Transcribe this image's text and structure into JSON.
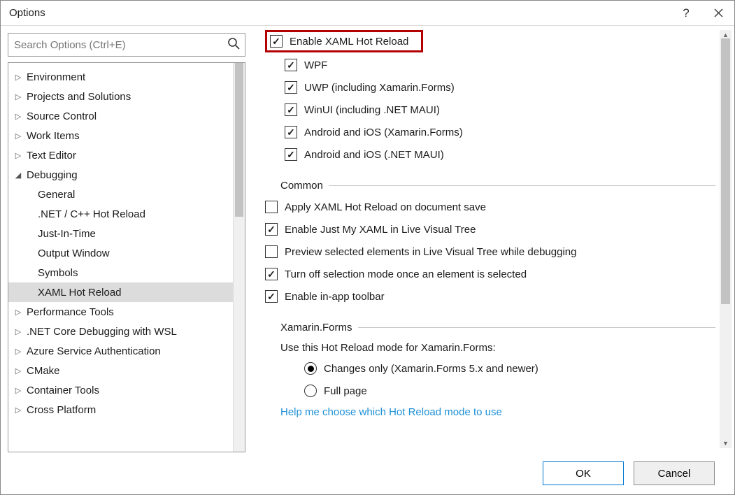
{
  "window": {
    "title": "Options"
  },
  "search": {
    "placeholder": "Search Options (Ctrl+E)"
  },
  "tree": [
    {
      "label": "Environment",
      "expanded": false,
      "level": 0
    },
    {
      "label": "Projects and Solutions",
      "expanded": false,
      "level": 0
    },
    {
      "label": "Source Control",
      "expanded": false,
      "level": 0
    },
    {
      "label": "Work Items",
      "expanded": false,
      "level": 0
    },
    {
      "label": "Text Editor",
      "expanded": false,
      "level": 0
    },
    {
      "label": "Debugging",
      "expanded": true,
      "level": 0
    },
    {
      "label": "General",
      "level": 1
    },
    {
      "label": ".NET / C++ Hot Reload",
      "level": 1
    },
    {
      "label": "Just-In-Time",
      "level": 1
    },
    {
      "label": "Output Window",
      "level": 1
    },
    {
      "label": "Symbols",
      "level": 1
    },
    {
      "label": "XAML Hot Reload",
      "level": 1,
      "selected": true
    },
    {
      "label": "Performance Tools",
      "expanded": false,
      "level": 0
    },
    {
      "label": ".NET Core Debugging with WSL",
      "expanded": false,
      "level": 0
    },
    {
      "label": "Azure Service Authentication",
      "expanded": false,
      "level": 0
    },
    {
      "label": "CMake",
      "expanded": false,
      "level": 0
    },
    {
      "label": "Container Tools",
      "expanded": false,
      "level": 0
    },
    {
      "label": "Cross Platform",
      "expanded": false,
      "level": 0
    }
  ],
  "main": {
    "enable": {
      "label": "Enable XAML Hot Reload",
      "checked": true
    },
    "platforms": [
      {
        "label": "WPF",
        "checked": true
      },
      {
        "label": "UWP (including Xamarin.Forms)",
        "checked": true
      },
      {
        "label": "WinUI (including .NET MAUI)",
        "checked": true
      },
      {
        "label": "Android and iOS (Xamarin.Forms)",
        "checked": true
      },
      {
        "label": "Android and iOS (.NET MAUI)",
        "checked": true
      }
    ],
    "commonHead": "Common",
    "common": [
      {
        "label": "Apply XAML Hot Reload on document save",
        "checked": false
      },
      {
        "label": "Enable Just My XAML in Live Visual Tree",
        "checked": true
      },
      {
        "label": "Preview selected elements in Live Visual Tree while debugging",
        "checked": false
      },
      {
        "label": "Turn off selection mode once an element is selected",
        "checked": true
      },
      {
        "label": "Enable in-app toolbar",
        "checked": true
      }
    ],
    "xamarinHead": "Xamarin.Forms",
    "xamarinPrompt": "Use this Hot Reload mode for Xamarin.Forms:",
    "radios": [
      {
        "label": "Changes only (Xamarin.Forms 5.x and newer)",
        "checked": true
      },
      {
        "label": "Full page",
        "checked": false
      }
    ],
    "helpLink": "Help me choose which Hot Reload mode to use"
  },
  "buttons": {
    "ok": "OK",
    "cancel": "Cancel"
  }
}
